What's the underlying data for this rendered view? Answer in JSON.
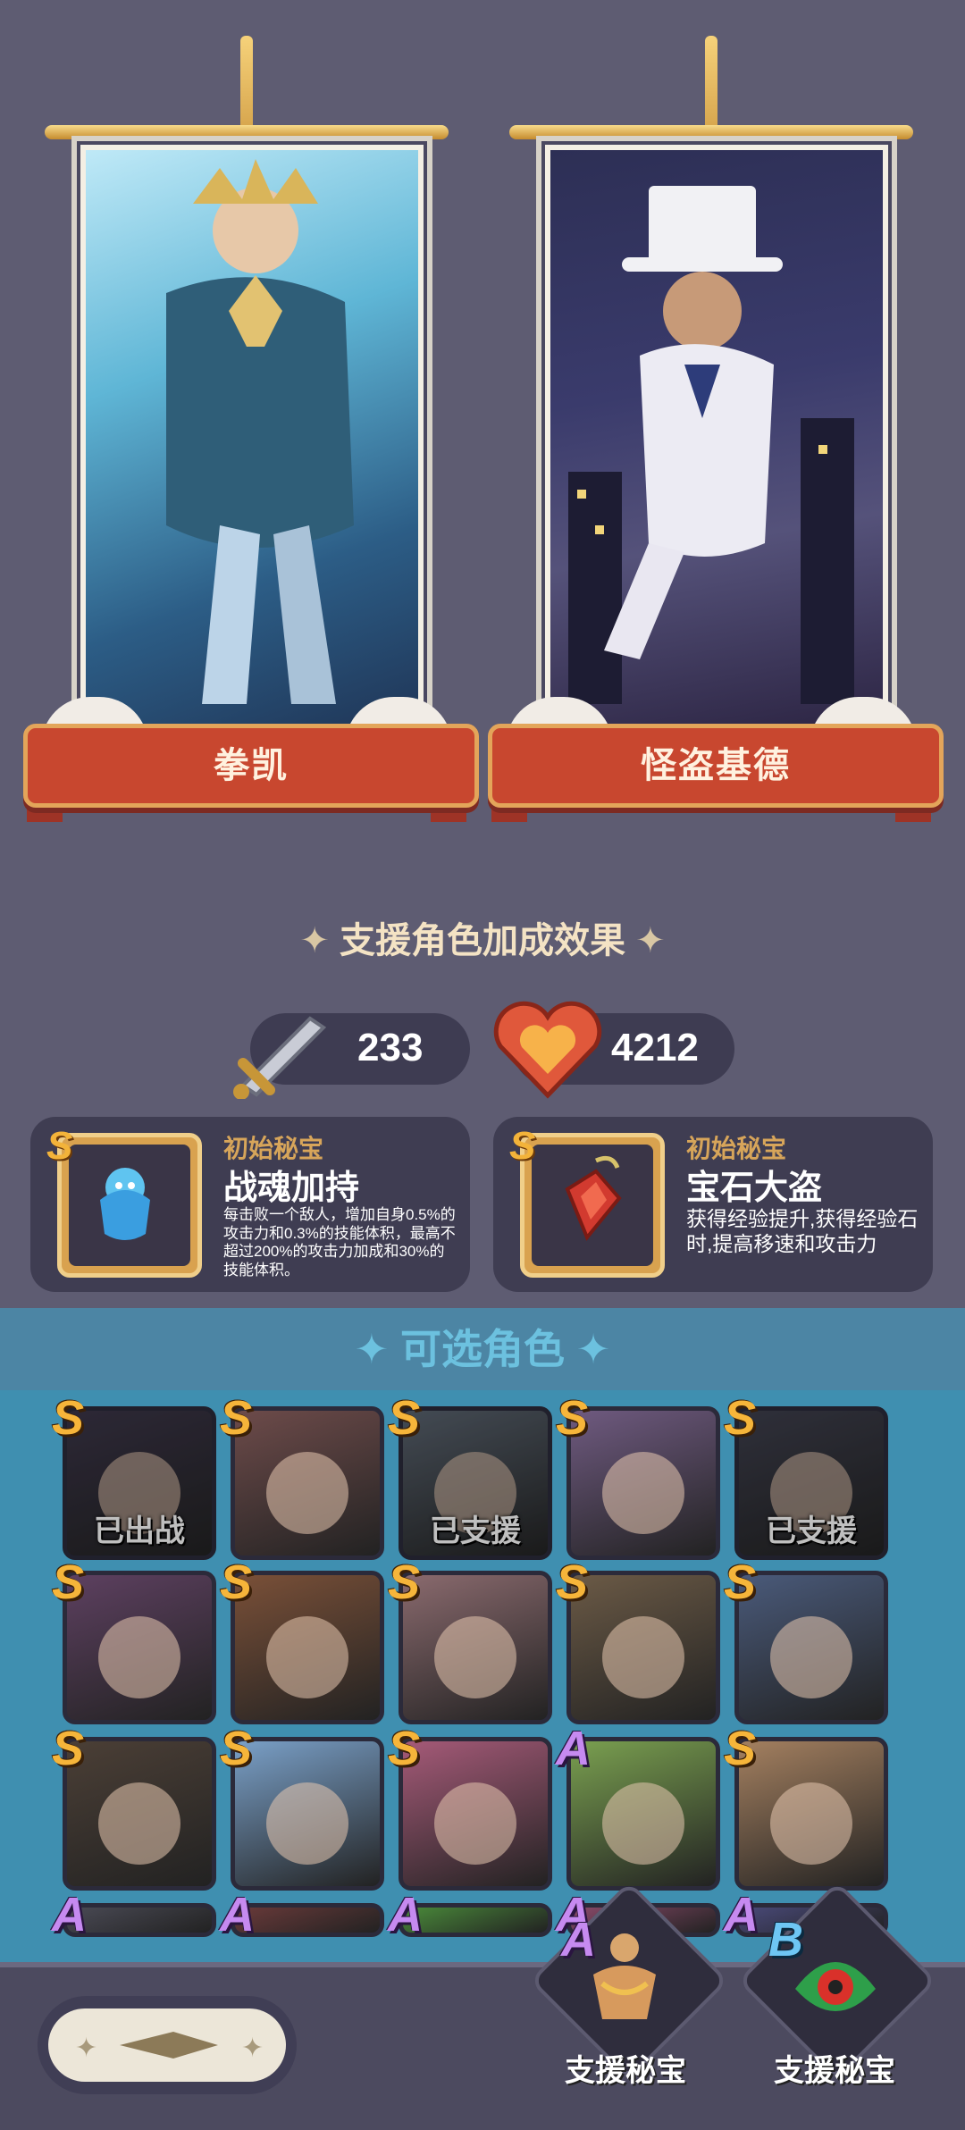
{
  "featured": [
    {
      "name": "拳凯"
    },
    {
      "name": "怪盗基德"
    }
  ],
  "bonus": {
    "title": "支援角色加成效果",
    "attack": "233",
    "hp": "4212"
  },
  "treasures": [
    {
      "tier": "S",
      "label": "初始秘宝",
      "name": "战魂加持",
      "desc": "每击败一个敌人，增加自身0.5%的攻击力和0.3%的技能体积，最高不超过200%的攻击力加成和30%的技能体积。"
    },
    {
      "tier": "S",
      "label": "初始秘宝",
      "name": "宝石大盗",
      "desc": "获得经验提升,获得经验石时,提高移速和攻击力"
    }
  ],
  "roster": {
    "title": "可选角色",
    "rows": [
      [
        {
          "grade": "S",
          "status": "已出战"
        },
        {
          "grade": "S",
          "status": ""
        },
        {
          "grade": "S",
          "status": "已支援"
        },
        {
          "grade": "S",
          "status": ""
        },
        {
          "grade": "S",
          "status": "已支援"
        }
      ],
      [
        {
          "grade": "S",
          "status": ""
        },
        {
          "grade": "S",
          "status": ""
        },
        {
          "grade": "S",
          "status": ""
        },
        {
          "grade": "S",
          "status": ""
        },
        {
          "grade": "S",
          "status": ""
        }
      ],
      [
        {
          "grade": "S",
          "status": ""
        },
        {
          "grade": "S",
          "status": ""
        },
        {
          "grade": "S",
          "status": ""
        },
        {
          "grade": "A",
          "status": ""
        },
        {
          "grade": "S",
          "status": ""
        }
      ],
      [
        {
          "grade": "A",
          "status": ""
        },
        {
          "grade": "A",
          "status": ""
        },
        {
          "grade": "A",
          "status": ""
        },
        {
          "grade": "A",
          "status": ""
        },
        {
          "grade": "A",
          "status": ""
        }
      ]
    ]
  },
  "bottom": {
    "support1": {
      "grade": "A",
      "label": "支援秘宝"
    },
    "support2": {
      "grade": "B",
      "label": "支援秘宝"
    }
  },
  "colors": {
    "accent_gold": "#f6b53a",
    "ribbon_red": "#c8472f",
    "panel": "#3f3d52"
  }
}
